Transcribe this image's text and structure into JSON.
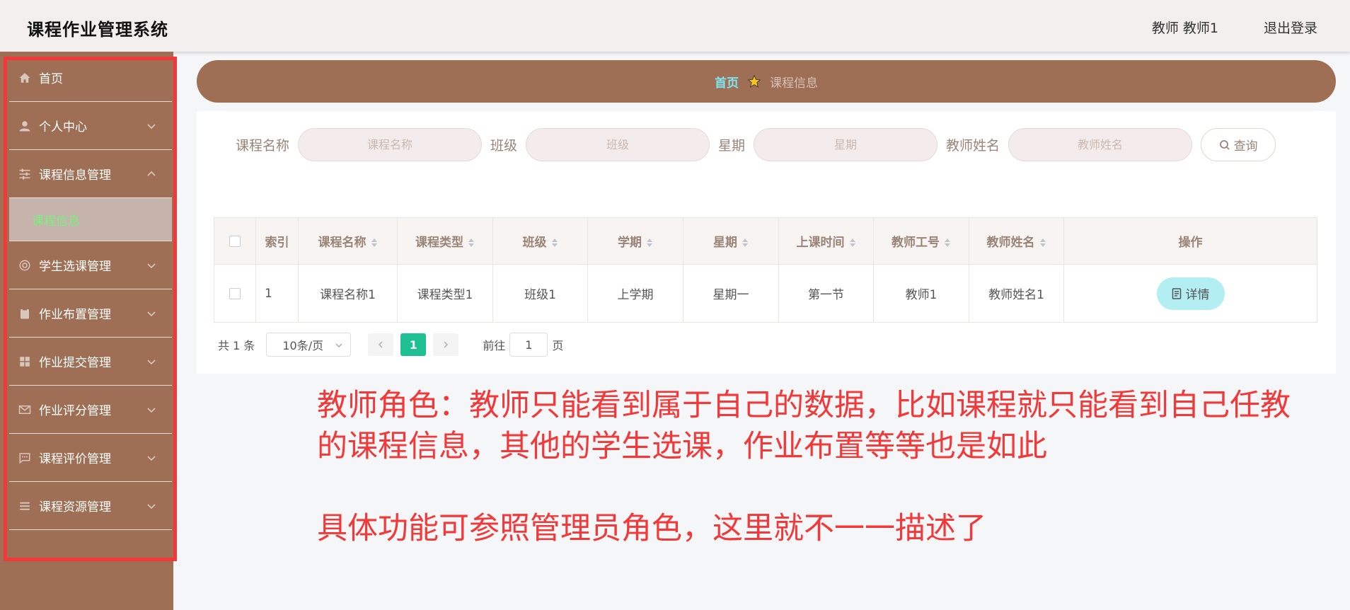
{
  "header": {
    "title": "课程作业管理系统",
    "user": "教师 教师1",
    "logout": "退出登录"
  },
  "sidebar": {
    "items": [
      {
        "label": "首页",
        "icon": "home-icon"
      },
      {
        "label": "个人中心",
        "icon": "user-icon"
      },
      {
        "label": "课程信息管理",
        "icon": "sliders-icon"
      },
      {
        "label": "学生选课管理",
        "icon": "circle-icon"
      },
      {
        "label": "作业布置管理",
        "icon": "clipboard-icon"
      },
      {
        "label": "作业提交管理",
        "icon": "grid-icon"
      },
      {
        "label": "作业评分管理",
        "icon": "mail-icon"
      },
      {
        "label": "课程评价管理",
        "icon": "chat-icon"
      },
      {
        "label": "课程资源管理",
        "icon": "list-icon"
      }
    ],
    "active_sub": "课程信息"
  },
  "breadcrumb": {
    "home": "首页",
    "current": "课程信息"
  },
  "search": {
    "fields": [
      {
        "label": "课程名称",
        "placeholder": "课程名称"
      },
      {
        "label": "班级",
        "placeholder": "班级"
      },
      {
        "label": "星期",
        "placeholder": "星期"
      },
      {
        "label": "教师姓名",
        "placeholder": "教师姓名"
      }
    ],
    "button": "查询"
  },
  "table": {
    "headers": [
      "索引",
      "课程名称",
      "课程类型",
      "班级",
      "学期",
      "星期",
      "上课时间",
      "教师工号",
      "教师姓名",
      "操作"
    ],
    "rows": [
      {
        "index": "1",
        "course_name": "课程名称1",
        "course_type": "课程类型1",
        "class": "班级1",
        "term": "上学期",
        "weekday": "星期一",
        "time": "第一节",
        "teacher_id": "教师1",
        "teacher_name": "教师姓名1",
        "action": "详情"
      }
    ]
  },
  "pagination": {
    "total": "共 1 条",
    "page_size": "10条/页",
    "current_page": "1",
    "goto_label": "前往",
    "goto_value": "1",
    "page_suffix": "页"
  },
  "annotation": {
    "line1": "教师角色：教师只能看到属于自己的数据，比如课程就只能看到自己任教",
    "line2": "的课程信息，其他的学生选课，作业布置等等也是如此",
    "line3": "具体功能可参照管理员角色，这里就不一一描述了"
  },
  "colors": {
    "sidebar_bg": "#9e6f54",
    "header_bg": "#f4efef",
    "breadcrumb_home": "#7ee6f2",
    "active_sub": "#7cf07e",
    "annotation_red": "#f23838",
    "page_active": "#1fbf94",
    "detail_btn": "#b3eef2"
  }
}
